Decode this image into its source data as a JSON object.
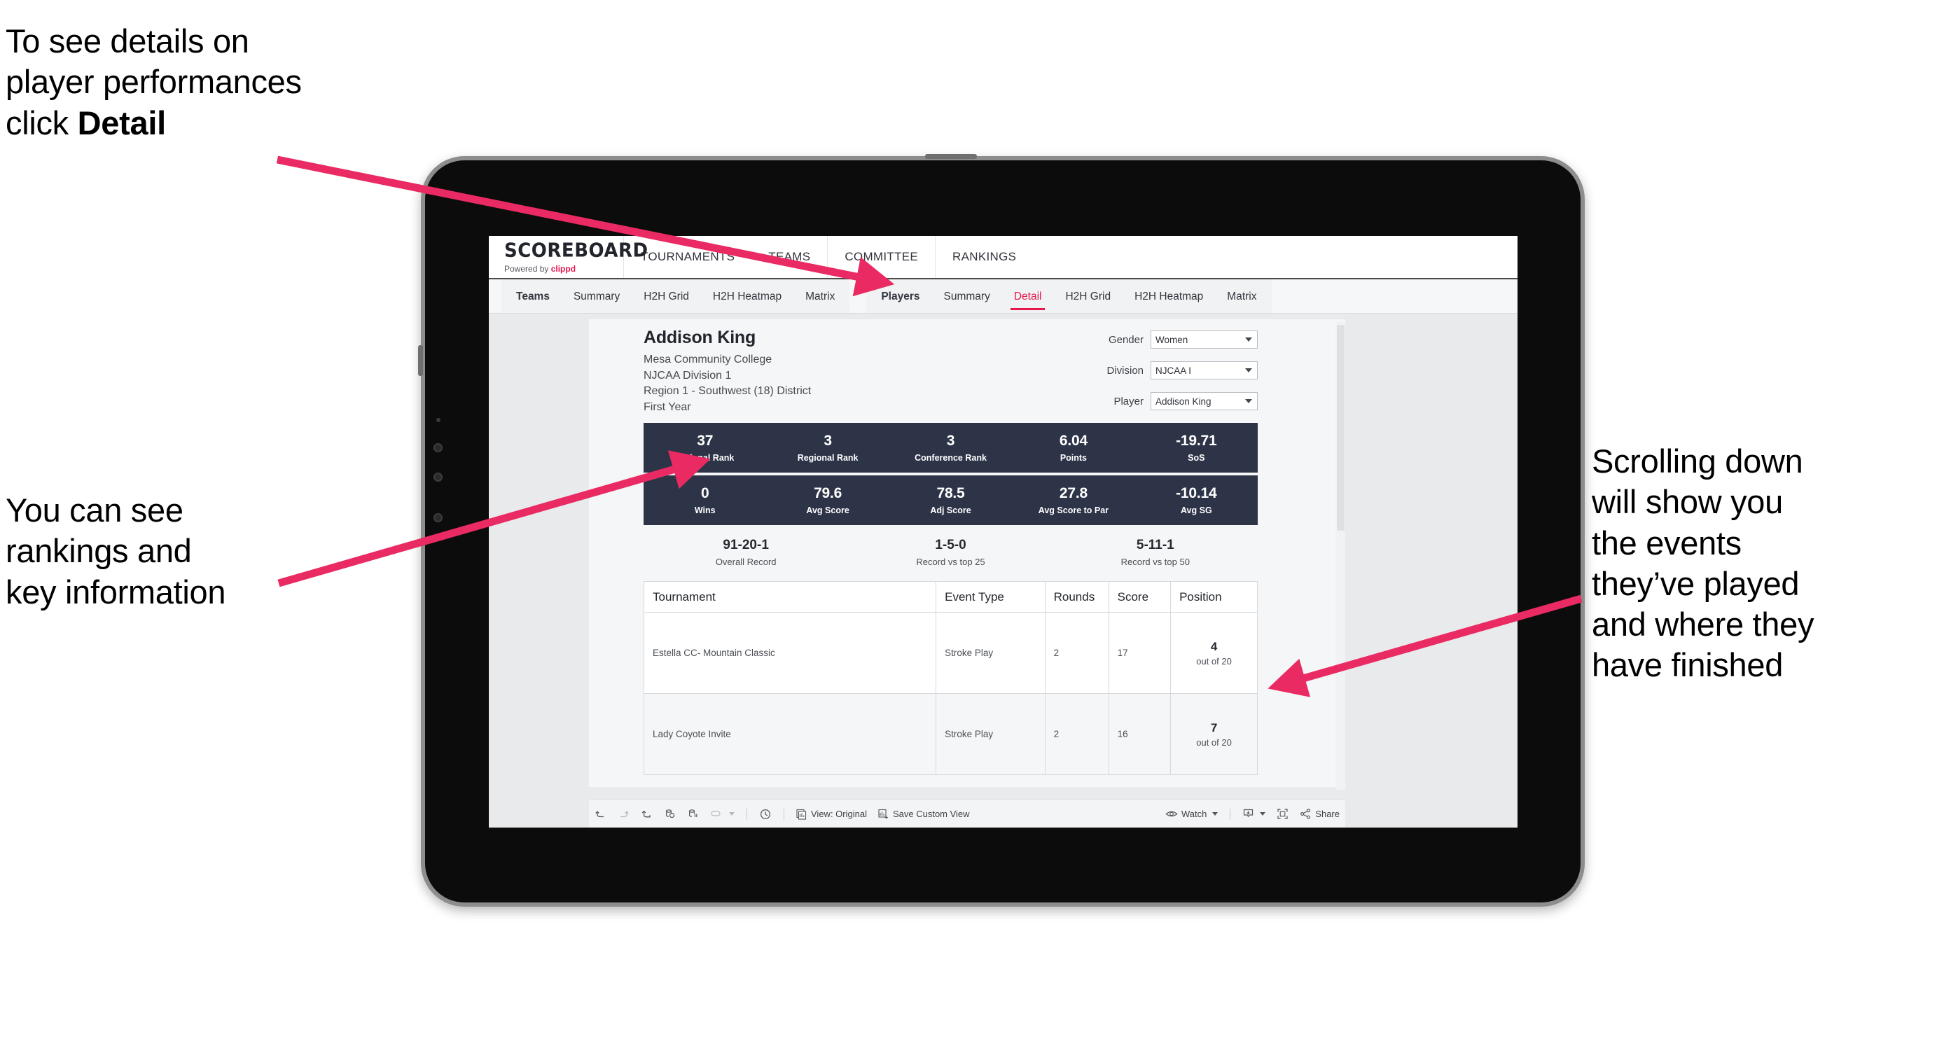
{
  "annotations": {
    "top_left": {
      "line1": "To see details on",
      "line2": "player performances",
      "line3_prefix": "click ",
      "line3_strong": "Detail"
    },
    "mid_left": {
      "line1": "You can see",
      "line2": "rankings and",
      "line3": "key information"
    },
    "right": {
      "line1": "Scrolling down",
      "line2": "will show you",
      "line3": "the events",
      "line4": "they’ve played",
      "line5": "and where they",
      "line6": "have finished"
    },
    "arrow_color": "#ea2a62"
  },
  "app": {
    "brand": {
      "name": "SCOREBOARD",
      "powered_prefix": "Powered by ",
      "powered_brand": "clippd"
    },
    "top_nav": [
      {
        "label": "TOURNAMENTS"
      },
      {
        "label": "TEAMS"
      },
      {
        "label": "COMMITTEE"
      },
      {
        "label": "RANKINGS"
      }
    ],
    "tabs_teams": [
      {
        "label": "Teams",
        "bold": true,
        "active": false
      },
      {
        "label": "Summary",
        "bold": false,
        "active": false
      },
      {
        "label": "H2H Grid",
        "bold": false,
        "active": false
      },
      {
        "label": "H2H Heatmap",
        "bold": false,
        "active": false
      },
      {
        "label": "Matrix",
        "bold": false,
        "active": false
      }
    ],
    "tabs_players": [
      {
        "label": "Players",
        "bold": true,
        "active": false
      },
      {
        "label": "Summary",
        "bold": false,
        "active": false
      },
      {
        "label": "Detail",
        "bold": false,
        "active": true
      },
      {
        "label": "H2H Grid",
        "bold": false,
        "active": false
      },
      {
        "label": "H2H Heatmap",
        "bold": false,
        "active": false
      },
      {
        "label": "Matrix",
        "bold": false,
        "active": false
      }
    ],
    "accent_color": "#e8174c",
    "statbar_color": "#2e3448"
  },
  "player": {
    "name": "Addison King",
    "school": "Mesa Community College",
    "division": "NJCAA Division 1",
    "region": "Region 1 - Southwest (18) District",
    "year": "First Year"
  },
  "filters": [
    {
      "label": "Gender",
      "value": "Women"
    },
    {
      "label": "Division",
      "value": "NJCAA I"
    },
    {
      "label": "Player",
      "value": "Addison King"
    }
  ],
  "stats_row1": [
    {
      "value": "37",
      "label": "National Rank"
    },
    {
      "value": "3",
      "label": "Regional Rank"
    },
    {
      "value": "3",
      "label": "Conference Rank"
    },
    {
      "value": "6.04",
      "label": "Points"
    },
    {
      "value": "-19.71",
      "label": "SoS"
    }
  ],
  "stats_row2": [
    {
      "value": "0",
      "label": "Wins"
    },
    {
      "value": "79.6",
      "label": "Avg Score"
    },
    {
      "value": "78.5",
      "label": "Adj Score"
    },
    {
      "value": "27.8",
      "label": "Avg Score to Par"
    },
    {
      "value": "-10.14",
      "label": "Avg SG"
    }
  ],
  "records": [
    {
      "value": "91-20-1",
      "label": "Overall Record"
    },
    {
      "value": "1-5-0",
      "label": "Record vs top 25"
    },
    {
      "value": "5-11-1",
      "label": "Record vs top 50"
    }
  ],
  "events_table": {
    "columns": [
      "Tournament",
      "Event Type",
      "Rounds",
      "Score",
      "Position"
    ],
    "rows": [
      {
        "tournament": "Estella CC- Mountain Classic",
        "event_type": "Stroke Play",
        "rounds": "2",
        "score": "17",
        "position_num": "4",
        "position_sub": "out of 20"
      },
      {
        "tournament": "Lady Coyote Invite",
        "event_type": "Stroke Play",
        "rounds": "2",
        "score": "16",
        "position_num": "7",
        "position_sub": "out of 20"
      }
    ]
  },
  "toolbar": {
    "view_label": "View: Original",
    "save_label": "Save Custom View",
    "watch_label": "Watch",
    "share_label": "Share"
  }
}
